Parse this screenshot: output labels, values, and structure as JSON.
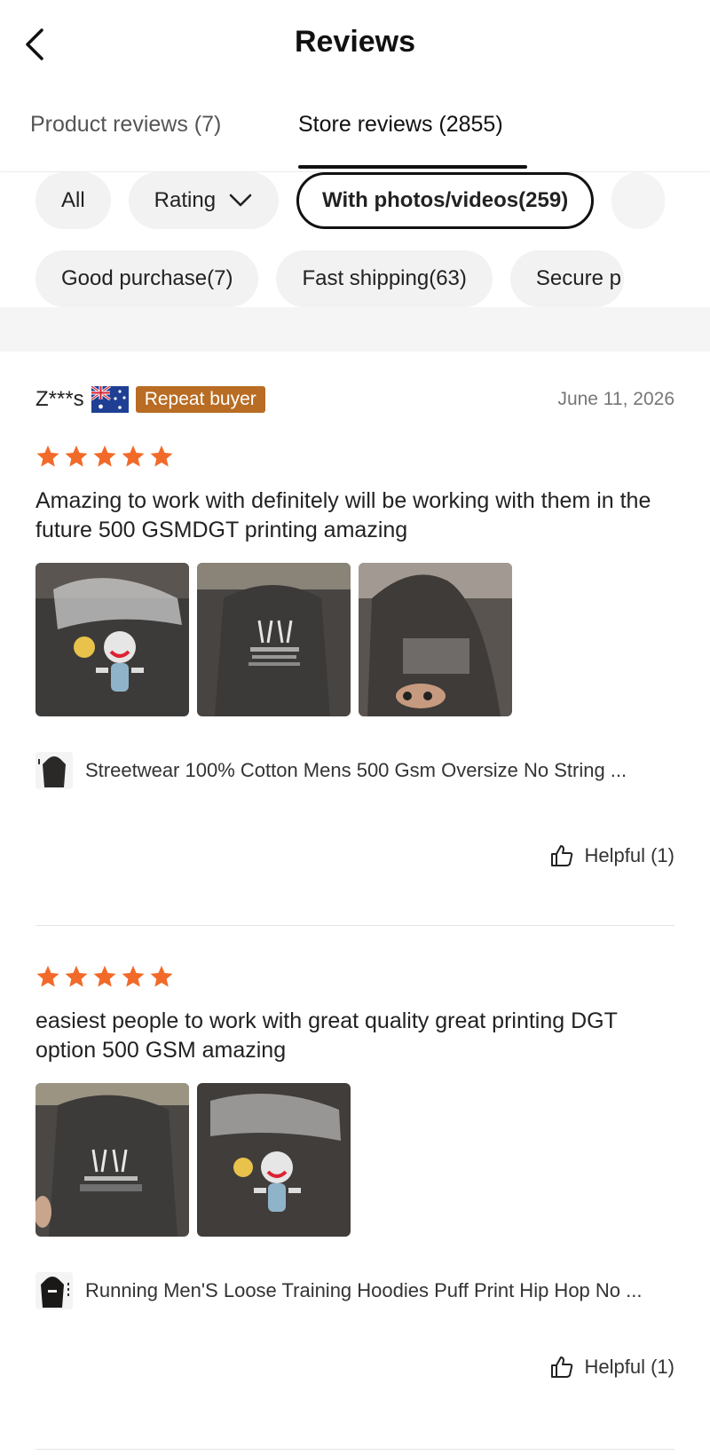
{
  "header": {
    "title": "Reviews",
    "back_icon": "chevron-left-icon"
  },
  "tabs": [
    {
      "label": "Product reviews (7)",
      "active": false
    },
    {
      "label": "Store reviews (2855)",
      "active": true
    }
  ],
  "filters": {
    "row1": [
      {
        "label": "All",
        "selected": false
      },
      {
        "label": "Rating",
        "selected": false,
        "icon": "chevron-down-icon"
      },
      {
        "label": "With photos/videos(259)",
        "selected": true
      }
    ],
    "row2": [
      {
        "label": "Good purchase(7)"
      },
      {
        "label": "Fast shipping(63)"
      },
      {
        "label": "Secure p"
      }
    ]
  },
  "reviews": [
    {
      "reviewer": "Z***s",
      "flag": "australia-flag-icon",
      "badge": "Repeat buyer",
      "date": "June 11, 2026",
      "rating": 5,
      "text": "Amazing to work with definitely will be working with them in the future 500 GSMDGT printing amazing",
      "photo_count": 3,
      "product_name": "Streetwear 100% Cotton Mens 500 Gsm Oversize No String ...",
      "helpful": "Helpful (1)"
    },
    {
      "rating": 5,
      "text": "easiest people to work with great quality great printing DGT option 500 GSM amazing",
      "photo_count": 2,
      "product_name": "Running Men'S Loose Training Hoodies Puff Print Hip Hop No ...",
      "helpful": "Helpful (1)"
    }
  ],
  "colors": {
    "star": "#f26a2a",
    "badge": "#b86c24",
    "selected_border": "#111111",
    "chip_bg": "#f2f2f2"
  }
}
